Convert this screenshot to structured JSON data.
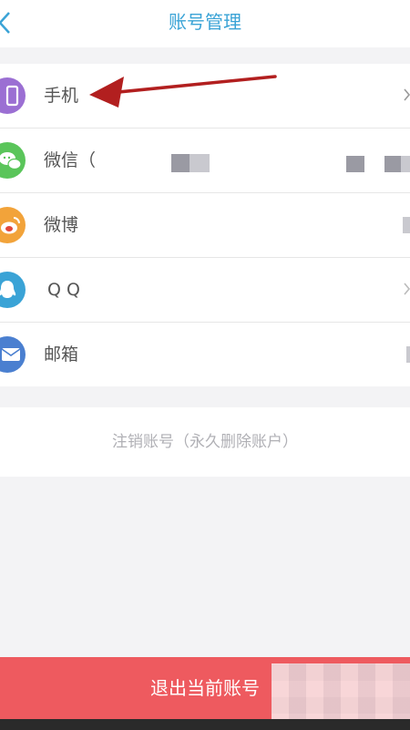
{
  "header": {
    "title": "账号管理"
  },
  "accounts": [
    {
      "label": "手机",
      "icon": "phone-icon",
      "color": "#9b6fd3"
    },
    {
      "label": "微信（",
      "icon": "wechat-icon",
      "color": "#5ac55a"
    },
    {
      "label": "微博",
      "icon": "weibo-icon",
      "color": "#f2a33a"
    },
    {
      "label": "Q Q",
      "icon": "qq-icon",
      "color": "#3aa3d6"
    },
    {
      "label": "邮箱",
      "icon": "mail-icon",
      "color": "#4a7fd0"
    }
  ],
  "deactivate": {
    "label": "注销账号（永久删除账户）"
  },
  "logout": {
    "label": "退出当前账号"
  },
  "colors": {
    "accent": "#3aa3d6",
    "danger": "#ee5a5f",
    "annotation": "#b21f1f"
  }
}
